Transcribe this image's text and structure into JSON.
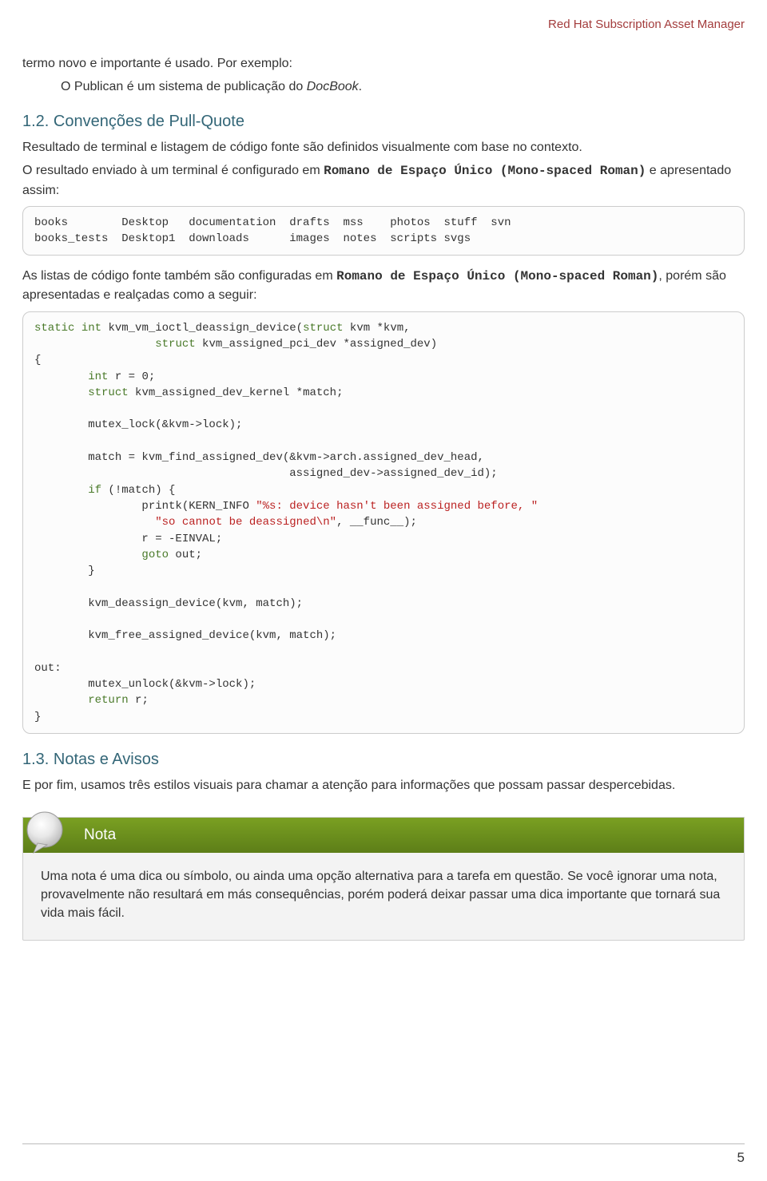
{
  "running_head": "Red Hat Subscription Asset Manager",
  "intro": {
    "line1_a": "termo novo e importante é usado. Por exemplo:",
    "line2_a": "O Publican é um sistema de publicação do ",
    "line2_b": "DocBook",
    "line2_c": "."
  },
  "sec12": {
    "heading": "1.2. Convenções de Pull-Quote",
    "p1": "Resultado de terminal e listagem de código fonte são definidos visualmente com base no contexto.",
    "p2_a": "O resultado enviado à um terminal é configurado em ",
    "p2_mono": "Romano de Espaço Único (Mono-spaced Roman)",
    "p2_b": " e apresentado assim:"
  },
  "screen_output": "books        Desktop   documentation  drafts  mss    photos  stuff  svn\nbooks_tests  Desktop1  downloads      images  notes  scripts svgs",
  "after_screen": {
    "a": "As listas de código fonte também são configuradas em ",
    "mono": "Romano de Espaço Único (Mono-spaced Roman)",
    "b": ", porém são apresentadas e realçadas como a seguir:"
  },
  "code": {
    "l01a": "static",
    "l01b": " ",
    "l01c": "int",
    "l01d": " kvm_vm_ioctl_deassign_device(",
    "l01e": "struct",
    "l01f": " kvm *kvm,",
    "l02a": "                  ",
    "l02b": "struct",
    "l02c": " kvm_assigned_pci_dev *assigned_dev)",
    "l03": "{",
    "l04a": "        ",
    "l04b": "int",
    "l04c": " r = 0;",
    "l05a": "        ",
    "l05b": "struct",
    "l05c": " kvm_assigned_dev_kernel *match;",
    "l06": "",
    "l07": "        mutex_lock(&kvm->lock);",
    "l08": "",
    "l09": "        match = kvm_find_assigned_dev(&kvm->arch.assigned_dev_head,",
    "l10": "                                      assigned_dev->assigned_dev_id);",
    "l11a": "        ",
    "l11b": "if",
    "l11c": " (!match) {",
    "l12a": "                printk(KERN_INFO ",
    "l12b": "\"%s: device hasn't been assigned before, \"",
    "l13a": "                  ",
    "l13b": "\"so cannot be deassigned\\n\"",
    "l13c": ", __func__);",
    "l14": "                r = -EINVAL;",
    "l15a": "                ",
    "l15b": "goto",
    "l15c": " out;",
    "l16": "        }",
    "l17": "",
    "l18": "        kvm_deassign_device(kvm, match);",
    "l19": "",
    "l20": "        kvm_free_assigned_device(kvm, match);",
    "l21": "",
    "l22": "out:",
    "l23": "        mutex_unlock(&kvm->lock);",
    "l24a": "        ",
    "l24b": "return",
    "l24c": " r;",
    "l25": "}"
  },
  "sec13": {
    "heading": "1.3. Notas e Avisos",
    "p1": "E por fim, usamos três estilos visuais para chamar a atenção para informações que possam passar despercebidas."
  },
  "nota": {
    "label": "Nota",
    "body": "Uma nota é uma dica ou símbolo, ou ainda uma opção alternativa para a tarefa em questão. Se você ignorar uma nota, provavelmente não resultará em más consequências, porém poderá deixar passar uma dica importante que tornará sua vida mais fácil."
  },
  "page_number": "5"
}
